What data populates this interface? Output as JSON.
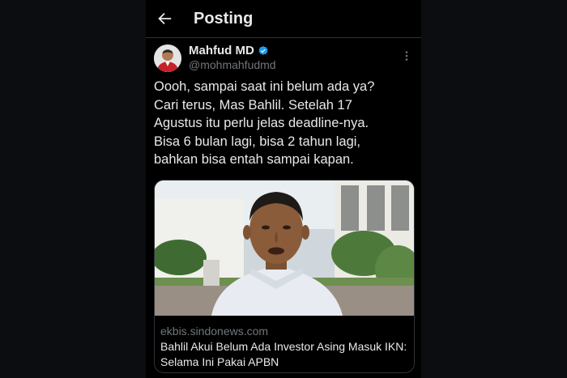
{
  "header": {
    "title": "Posting",
    "back_icon": "arrow-left-icon"
  },
  "tweet": {
    "author_name": "Mahfud MD",
    "author_handle": "@mohmahfudmd",
    "verified": true,
    "text": "Oooh, sampai saat ini belum ada ya?\nCari terus, Mas Bahlil. Setelah 17\nAgustus itu perlu jelas deadline-nya.\nBisa 6 bulan lagi, bisa 2 tahun lagi,\nbahkan bisa entah sampai kapan."
  },
  "link_card": {
    "domain": "ekbis.sindonews.com",
    "title": "Bahlil Akui Belum Ada Investor Asing Masuk IKN: Selama Ini Pakai APBN"
  },
  "colors": {
    "background": "#000000",
    "text": "#e7e9ea",
    "muted": "#71767b",
    "verified": "#1d9bf0",
    "border": "#2f3336"
  }
}
